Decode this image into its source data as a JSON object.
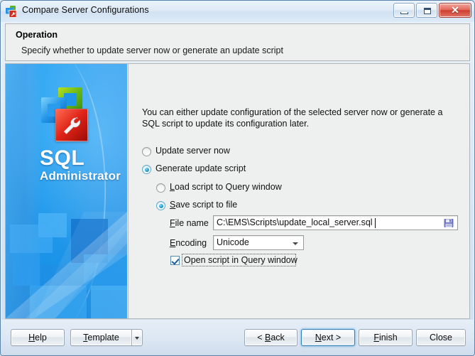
{
  "window": {
    "title": "Compare Server Configurations",
    "icon": "app-logo-icon",
    "controls": {
      "minimize": "minimize-icon",
      "maximize": "maximize-icon",
      "close": "✕"
    }
  },
  "header": {
    "title": "Operation",
    "subtitle": "Specify whether to update server now or generate an update script"
  },
  "sidebar": {
    "brand_line1": "SQL",
    "brand_line2": "Administrator"
  },
  "content": {
    "intro": "You can either update configuration of the selected server now or generate a SQL script to update its configuration later.",
    "options": [
      {
        "label": "Update server now",
        "selected": false
      },
      {
        "label": "Generate update script",
        "selected": true
      }
    ],
    "sub_options": [
      {
        "label": "Load script to Query window",
        "accel": "L",
        "selected": false
      },
      {
        "label": "Save script to file",
        "accel": "S",
        "selected": true
      }
    ],
    "fields": {
      "file_name_label": "File name",
      "file_name_accel": "F",
      "file_name_value": "C:\\EMS\\Scripts\\update_local_server.sql",
      "save_button_icon": "floppy-save-icon",
      "encoding_label": "Encoding",
      "encoding_accel": "E",
      "encoding_value": "Unicode",
      "encoding_options": [
        "Unicode"
      ]
    },
    "checkbox": {
      "label": "Open script in Query window",
      "checked": true,
      "focused": true
    }
  },
  "footer": {
    "help": "Help",
    "template": "Template",
    "template_dropdown": "chevron-down-icon",
    "back": "< Back",
    "next": "Next >",
    "finish": "Finish",
    "close": "Close"
  },
  "colors": {
    "accent": "#1a9ad6",
    "brand_blue": "#2a9cee",
    "close_red": "#cf3f2f"
  }
}
